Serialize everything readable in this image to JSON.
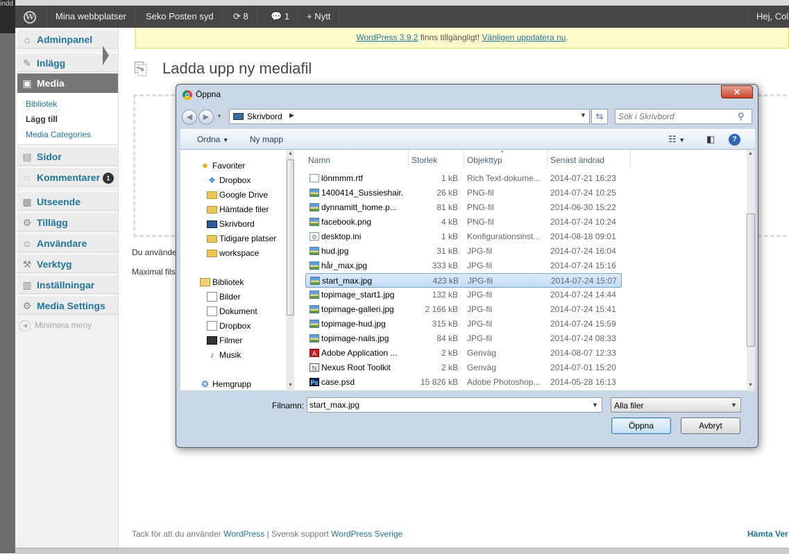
{
  "admin_bar": {
    "wp_logo": "W",
    "my_sites": "Mina webbplatser",
    "site_name": "Seko Posten syd",
    "updates_count": "8",
    "comments_count": "1",
    "new_label": "Nytt",
    "greeting": "Hej, Col"
  },
  "sidebar": {
    "items": [
      {
        "label": "Adminpanel",
        "icon": "dashboard-icon"
      },
      {
        "label": "Inlägg",
        "icon": "pin-icon"
      },
      {
        "label": "Media",
        "icon": "media-icon"
      },
      {
        "label": "Sidor",
        "icon": "pages-icon"
      },
      {
        "label": "Kommentarer",
        "icon": "comments-icon",
        "badge": "1"
      },
      {
        "label": "Utseende",
        "icon": "appearance-icon"
      },
      {
        "label": "Tillägg",
        "icon": "plugins-icon"
      },
      {
        "label": "Användare",
        "icon": "users-icon"
      },
      {
        "label": "Verktyg",
        "icon": "tools-icon"
      },
      {
        "label": "Inställningar",
        "icon": "settings-icon"
      },
      {
        "label": "Media Settings",
        "icon": "gear-icon"
      }
    ],
    "media_submenu": [
      "Bibliotek",
      "Lägg till",
      "Media Categories"
    ],
    "collapse": "Minimera meny"
  },
  "notice": {
    "link1": "WordPress 3.9.2",
    "text": " finns tillgängligt! ",
    "link2": "Vänligen uppdatera nu",
    "end": "."
  },
  "page": {
    "title": "Ladda upp ny mediafil",
    "partial1": "Du använde",
    "partial2": "Maximal fils"
  },
  "footer": {
    "text1": "Tack för att du använder ",
    "link1": "WordPress",
    "text2": " | Svensk support ",
    "link2": "WordPress Sverige",
    "right": "Hämta Ver"
  },
  "dialog": {
    "title": "Öppna",
    "close": "✕",
    "address": "Skrivbord",
    "search_placeholder": "Sök i Skrivbord",
    "toolbar": {
      "organize": "Ordna",
      "new_folder": "Ny mapp"
    },
    "nav": {
      "favorites_header": "Favoriter",
      "favorites": [
        "Dropbox",
        "Google Drive",
        "Hämtade filer",
        "Skrivbord",
        "Tidigare platser",
        "workspace"
      ],
      "libraries_header": "Bibliotek",
      "libraries": [
        "Bilder",
        "Dokument",
        "Dropbox",
        "Filmer",
        "Musik"
      ],
      "homegroup": "Hemgrupp"
    },
    "columns": [
      "Namn",
      "Storlek",
      "Objekttyp",
      "Senast ändrad"
    ],
    "files": [
      {
        "name": "lönmmm.rtf",
        "size": "1 kB",
        "type": "Rich Text-dokume...",
        "date": "2014-07-21 16:23",
        "icon": "text"
      },
      {
        "name": "1400414_Sussieshair...",
        "size": "26 kB",
        "type": "PNG-fil",
        "date": "2014-07-24 10:25",
        "icon": "image"
      },
      {
        "name": "dynnamitt_home.p...",
        "size": "81 kB",
        "type": "PNG-fil",
        "date": "2014-06-30 15:22",
        "icon": "image"
      },
      {
        "name": "facebook.png",
        "size": "4 kB",
        "type": "PNG-fil",
        "date": "2014-07-24 10:24",
        "icon": "image"
      },
      {
        "name": "desktop.ini",
        "size": "1 kB",
        "type": "Konfigurationsinst...",
        "date": "2014-08-18 09:01",
        "icon": "ini"
      },
      {
        "name": "hud.jpg",
        "size": "31 kB",
        "type": "JPG-fil",
        "date": "2014-07-24 16:04",
        "icon": "image"
      },
      {
        "name": "hår_max.jpg",
        "size": "333 kB",
        "type": "JPG-fil",
        "date": "2014-07-24 15:16",
        "icon": "image"
      },
      {
        "name": "start_max.jpg",
        "size": "423 kB",
        "type": "JPG-fil",
        "date": "2014-07-24 15:07",
        "icon": "image",
        "selected": true
      },
      {
        "name": "topimage_start1.jpg",
        "size": "132 kB",
        "type": "JPG-fil",
        "date": "2014-07-24 14:44",
        "icon": "image"
      },
      {
        "name": "topimage-galleri.jpg",
        "size": "2 166 kB",
        "type": "JPG-fil",
        "date": "2014-07-24 15:41",
        "icon": "image"
      },
      {
        "name": "topimage-hud.jpg",
        "size": "315 kB",
        "type": "JPG-fil",
        "date": "2014-07-24 15:59",
        "icon": "image"
      },
      {
        "name": "topimage-nails.jpg",
        "size": "84 kB",
        "type": "JPG-fil",
        "date": "2014-07-24 08:33",
        "icon": "image"
      },
      {
        "name": "Adobe Application ...",
        "size": "2 kB",
        "type": "Genväg",
        "date": "2014-08-07 12:33",
        "icon": "adobe"
      },
      {
        "name": "Nexus Root Toolkit",
        "size": "2 kB",
        "type": "Genväg",
        "date": "2014-07-01 15:20",
        "icon": "nexus"
      },
      {
        "name": "case.psd",
        "size": "15 826 kB",
        "type": "Adobe Photoshop...",
        "date": "2014-05-28 16:13",
        "icon": "psd"
      }
    ],
    "filename_label": "Filnamn:",
    "filename_value": "start_max.jpg",
    "filter": "Alla filer",
    "open_button": "Öppna",
    "cancel_button": "Avbryt"
  }
}
